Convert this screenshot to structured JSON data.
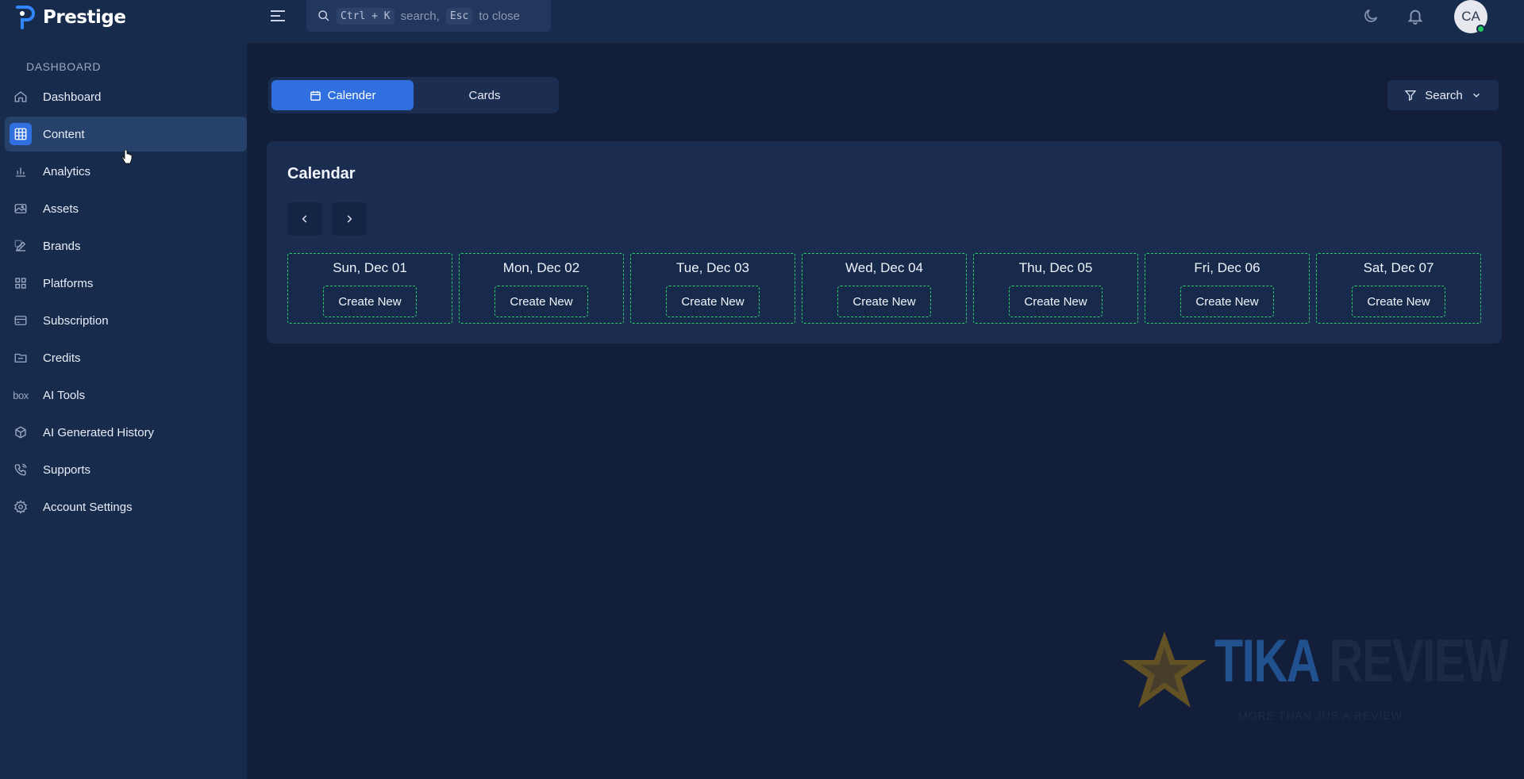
{
  "app": {
    "name": "Prestige",
    "logo_icon": "prestige-logo-icon"
  },
  "topbar": {
    "menu_icon": "hamburger-icon",
    "search": {
      "icon": "search-icon",
      "kbd1": "Ctrl + K",
      "mid": "search,",
      "kbd2": "Esc",
      "tail": "to close"
    },
    "theme_icon": "moon-icon",
    "notification_icon": "bell-icon",
    "avatar_initials": "CA",
    "status_color": "#22c55e"
  },
  "sidebar": {
    "section": "DASHBOARD",
    "items": [
      {
        "label": "Dashboard",
        "icon": "home-icon"
      },
      {
        "label": "Content",
        "icon": "grid-icon",
        "active": true
      },
      {
        "label": "Analytics",
        "icon": "bar-chart-icon"
      },
      {
        "label": "Assets",
        "icon": "image-icon"
      },
      {
        "label": "Brands",
        "icon": "edit-icon"
      },
      {
        "label": "Platforms",
        "icon": "apps-icon"
      },
      {
        "label": "Subscription",
        "icon": "card-icon"
      },
      {
        "label": "Credits",
        "icon": "folder-icon"
      },
      {
        "label": "AI Tools",
        "icon": "box-text-icon",
        "glyph": "box"
      },
      {
        "label": "AI Generated History",
        "icon": "cube-icon"
      },
      {
        "label": "Supports",
        "icon": "phone-icon"
      },
      {
        "label": "Account Settings",
        "icon": "gear-icon"
      }
    ]
  },
  "main": {
    "view_tabs": [
      {
        "label": "Calender",
        "icon": "calendar-icon",
        "active": true
      },
      {
        "label": "Cards",
        "active": false
      }
    ],
    "filter": {
      "label": "Search",
      "icon": "filter-icon",
      "chevron": "chevron-down-icon"
    },
    "calendar": {
      "title": "Calendar",
      "prev_icon": "chevron-left-icon",
      "next_icon": "chevron-right-icon",
      "days": [
        {
          "label": "Sun, Dec 01",
          "button": "Create New"
        },
        {
          "label": "Mon, Dec 02",
          "button": "Create New"
        },
        {
          "label": "Tue, Dec 03",
          "button": "Create New"
        },
        {
          "label": "Wed, Dec 04",
          "button": "Create New"
        },
        {
          "label": "Thu, Dec 05",
          "button": "Create New"
        },
        {
          "label": "Fri, Dec 06",
          "button": "Create New"
        },
        {
          "label": "Sat, Dec 07",
          "button": "Create New"
        }
      ]
    }
  },
  "watermark": {
    "title_a": "TIKA",
    "title_b": "REVIEW",
    "subtitle": "MORE THAN JUS A REVIEW"
  },
  "colors": {
    "accent": "#2f6fe0",
    "dashed_border": "#2fcb6b",
    "sidebar_bg": "#172b4d",
    "page_bg": "#131e3a"
  }
}
